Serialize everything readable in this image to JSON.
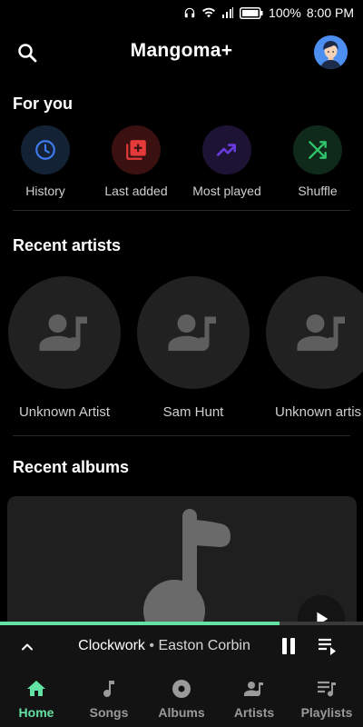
{
  "status_bar": {
    "battery_percent": "100%",
    "time": "8:00 PM"
  },
  "header": {
    "title": "Mangoma+"
  },
  "for_you": {
    "title": "For you",
    "items": [
      {
        "label": "History",
        "icon": "clock-icon",
        "color": "#3f7bf0",
        "bg": "#142235"
      },
      {
        "label": "Last added",
        "icon": "library-add-icon",
        "color": "#e43a3a",
        "bg": "#3a1010"
      },
      {
        "label": "Most played",
        "icon": "trending-up-icon",
        "color": "#6a3be0",
        "bg": "#1d1435"
      },
      {
        "label": "Shuffle",
        "icon": "shuffle-icon",
        "color": "#2fc46a",
        "bg": "#0f2a1a"
      }
    ]
  },
  "recent_artists": {
    "title": "Recent artists",
    "items": [
      {
        "label": "Unknown Artist"
      },
      {
        "label": "Sam Hunt"
      },
      {
        "label": "Unknown artis"
      }
    ]
  },
  "recent_albums": {
    "title": "Recent albums"
  },
  "player": {
    "song": "Clockwork",
    "separator": "•",
    "artist": "Easton Corbin",
    "progress": 0.77,
    "accent": "#64e2a4"
  },
  "nav": {
    "items": [
      {
        "label": "Home",
        "icon": "home-icon",
        "active": true
      },
      {
        "label": "Songs",
        "icon": "music-note-icon",
        "active": false
      },
      {
        "label": "Albums",
        "icon": "album-icon",
        "active": false
      },
      {
        "label": "Artists",
        "icon": "artist-icon",
        "active": false
      },
      {
        "label": "Playlists",
        "icon": "playlist-icon",
        "active": false
      }
    ]
  }
}
